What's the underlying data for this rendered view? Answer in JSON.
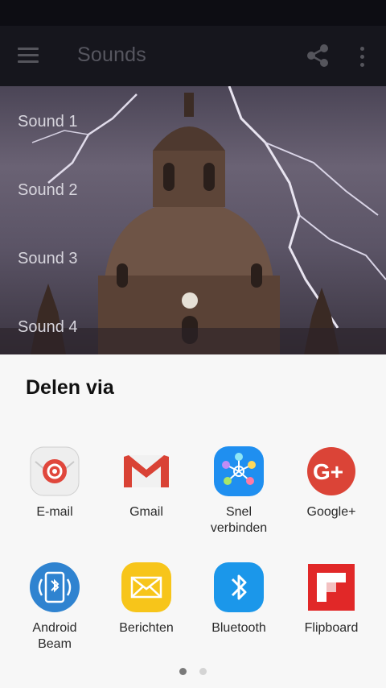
{
  "app_bar": {
    "title": "Sounds"
  },
  "sounds": [
    {
      "label": "Sound 1"
    },
    {
      "label": "Sound 2"
    },
    {
      "label": "Sound 3"
    },
    {
      "label": "Sound 4"
    }
  ],
  "share_sheet": {
    "title": "Delen via",
    "apps": [
      {
        "label": "E-mail",
        "icon": "email-icon"
      },
      {
        "label": "Gmail",
        "icon": "gmail-icon"
      },
      {
        "label": "Snel\nverbinden",
        "icon": "quick-connect-icon"
      },
      {
        "label": "Google+",
        "icon": "google-plus-icon"
      },
      {
        "label": "Android\nBeam",
        "icon": "android-beam-icon"
      },
      {
        "label": "Berichten",
        "icon": "messages-icon"
      },
      {
        "label": "Bluetooth",
        "icon": "bluetooth-icon"
      },
      {
        "label": "Flipboard",
        "icon": "flipboard-icon"
      }
    ],
    "page_indicator": {
      "current": 1,
      "total": 2
    }
  },
  "colors": {
    "app_bar": "#16161d",
    "sheet_background": "#f7f7f7",
    "active_dot": "#7a7a7a",
    "inactive_dot": "#d4d4d4"
  }
}
